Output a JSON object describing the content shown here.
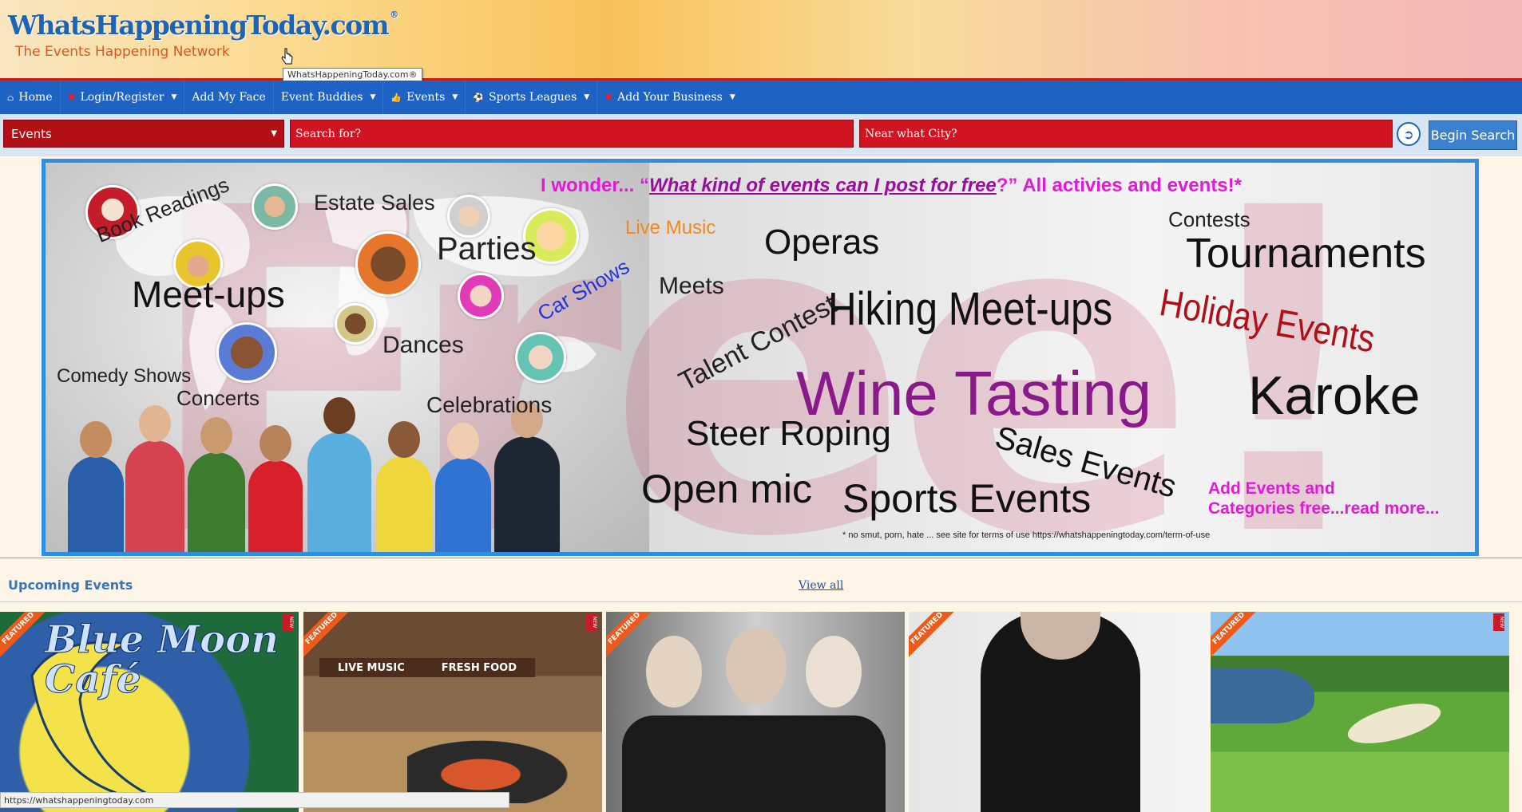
{
  "header": {
    "logo_text": "WhatsHappeningToday.com",
    "logo_registered": "®",
    "tagline": "The Events Happening Network",
    "tooltip": "WhatsHappeningToday.com®"
  },
  "nav": {
    "items": [
      {
        "label": "Home",
        "icon": "home-icon"
      },
      {
        "label": "Login/Register",
        "icon": "heart-icon"
      },
      {
        "label": "Add My Face"
      },
      {
        "label": "Event Buddies"
      },
      {
        "label": "Events",
        "icon": "thumbs-up-icon"
      },
      {
        "label": "Sports Leagues",
        "icon": "soccer-ball-icon"
      },
      {
        "label": "Add Your Business",
        "icon": "heart-icon"
      }
    ]
  },
  "search": {
    "category_value": "Events",
    "search_placeholder": "Search for?",
    "city_placeholder": "Near what City?",
    "submit_label": "Begin Search"
  },
  "banner": {
    "headline_prefix": "I wonder... “",
    "headline_link": "What kind of events can I post for free",
    "headline_suffix": "?”  All activies and events!*",
    "free_text": "Free!",
    "words": {
      "book_readings": "Book Readings",
      "estate_sales": "Estate Sales",
      "parties": "Parties",
      "meet_ups": "Meet-ups",
      "car_shows": "Car Shows",
      "live_music": "Live Music",
      "dances": "Dances",
      "comedy_shows": "Comedy Shows",
      "concerts": "Concerts",
      "celebrations": "Celebrations",
      "operas": "Operas",
      "meets": "Meets",
      "talent_contest": "Talent Contest",
      "hiking": "Hiking Meet-ups",
      "contests": "Contests",
      "tournaments": "Tournaments",
      "holiday": "Holiday Events",
      "wine": "Wine Tasting",
      "karoke": "Karoke",
      "steer": "Steer Roping",
      "sales_events": "Sales Events",
      "open_mic": "Open mic",
      "sports_events": "Sports Events",
      "add_events": "Add Events and",
      "categories": "Categories free...read more...",
      "disclaimer": "* no smut, porn, hate ... see site for terms of use https://whatshappeningtoday.com/term-of-use"
    }
  },
  "upcoming": {
    "title": "Upcoming Events",
    "view_all": "View all",
    "featured_label": "FEATURED",
    "new_label": "NEW",
    "cards": [
      {
        "name": "blue-moon-cafe",
        "caption": "Blue Moon Café",
        "has_new": true
      },
      {
        "name": "live-music-fresh-food",
        "caption_a": "LIVE MUSIC",
        "caption_b": "FRESH FOOD",
        "has_new": true
      },
      {
        "name": "band-photo",
        "has_new": false
      },
      {
        "name": "musician-photo",
        "has_new": false
      },
      {
        "name": "golf-course",
        "has_new": true
      }
    ]
  },
  "statusbar": {
    "url": "https://whatshappeningtoday.com"
  },
  "colors": {
    "nav_blue": "#1e63c3",
    "search_red": "#d11520",
    "headline_magenta": "#e01ad6",
    "wine_purple": "#8a1a8c",
    "holiday_red": "#b10f18",
    "featured_orange": "#ef5a1b"
  }
}
